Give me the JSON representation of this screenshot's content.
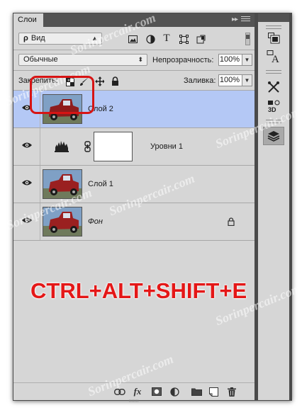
{
  "panel": {
    "tab_label": "Слои",
    "collapse_glyph": "▸▸",
    "menu_icon": "panel-menu-icon"
  },
  "filter": {
    "kind_label": "Вид",
    "search_glyph": "ρ",
    "icons": [
      "image-filter-icon",
      "adjustment-filter-icon",
      "type-filter-icon",
      "shape-filter-icon",
      "smart-object-filter-icon"
    ]
  },
  "blend": {
    "mode": "Обычные",
    "opacity_label": "Непрозрачность:",
    "opacity_value": "100%"
  },
  "lock": {
    "label": "Закрепить:",
    "fill_label": "Заливка:",
    "fill_value": "100%",
    "icons": [
      "lock-transparent-icon",
      "lock-paint-icon",
      "lock-move-icon",
      "lock-all-icon"
    ]
  },
  "layers": [
    {
      "name": "Слой 2",
      "selected": true,
      "italic": false,
      "type": "image",
      "locked": false
    },
    {
      "name": "Уровни 1",
      "selected": false,
      "italic": false,
      "type": "adjustment",
      "locked": false
    },
    {
      "name": "Слой 1",
      "selected": false,
      "italic": false,
      "type": "image",
      "locked": false
    },
    {
      "name": "Фон",
      "selected": false,
      "italic": true,
      "type": "image",
      "locked": true
    }
  ],
  "overlay": {
    "shortcut": "CTRL+ALT+SHIFT+E",
    "watermark": "Sorinpercair.com",
    "accent_color": "#e41717"
  },
  "bottom_icons": [
    "link-layers-icon",
    "fx-icon",
    "add-mask-icon",
    "new-adjustment-icon",
    "new-group-icon",
    "new-layer-icon",
    "delete-icon"
  ],
  "bottom_fx": "fx",
  "sidebar_icons": [
    "history-icon",
    "character-icon",
    "tools-icon",
    "3d-icon",
    "layers-icon"
  ],
  "colors": {
    "panel_bg": "#d6d6d6",
    "selected_row": "#b4c8f5",
    "dark_chrome": "#535353"
  }
}
